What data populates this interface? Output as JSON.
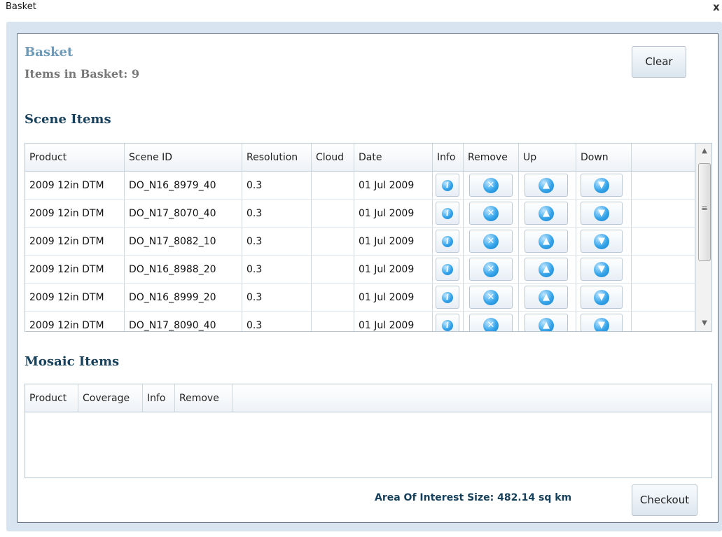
{
  "window": {
    "title": "Basket",
    "close_glyph": "x"
  },
  "header": {
    "title": "Basket",
    "count_text": "Items in Basket: 9"
  },
  "actions": {
    "clear_label": "Clear",
    "checkout_label": "Checkout"
  },
  "scene": {
    "section_title": "Scene Items",
    "columns": [
      "Product",
      "Scene ID",
      "Resolution",
      "Cloud",
      "Date",
      "Info",
      "Remove",
      "Up",
      "Down"
    ],
    "rows": [
      {
        "product": "2009 12in DTM",
        "scene_id": "DO_N16_8979_40",
        "resolution": "0.3",
        "cloud": "",
        "date": "01 Jul 2009"
      },
      {
        "product": "2009 12in DTM",
        "scene_id": "DO_N17_8070_40",
        "resolution": "0.3",
        "cloud": "",
        "date": "01 Jul 2009"
      },
      {
        "product": "2009 12in DTM",
        "scene_id": "DO_N17_8082_10",
        "resolution": "0.3",
        "cloud": "",
        "date": "01 Jul 2009"
      },
      {
        "product": "2009 12in DTM",
        "scene_id": "DO_N16_8988_20",
        "resolution": "0.3",
        "cloud": "",
        "date": "01 Jul 2009"
      },
      {
        "product": "2009 12in DTM",
        "scene_id": "DO_N16_8999_20",
        "resolution": "0.3",
        "cloud": "",
        "date": "01 Jul 2009"
      },
      {
        "product": "2009 12in DTM",
        "scene_id": "DO_N17_8090_40",
        "resolution": "0.3",
        "cloud": "",
        "date": "01 Jul 2009"
      }
    ]
  },
  "mosaic": {
    "section_title": "Mosaic Items",
    "columns": [
      "Product",
      "Coverage",
      "Info",
      "Remove"
    ]
  },
  "footer": {
    "aoi_text": "Area Of Interest Size: 482.14 sq km"
  },
  "icons": {
    "info": "info-icon",
    "remove": "remove-icon",
    "up": "move-up-icon",
    "down": "move-down-icon",
    "info_glyph": "i",
    "remove_glyph": "✕",
    "up_glyph": "▲",
    "down_glyph": "▼",
    "scroll_up_glyph": "▲",
    "scroll_down_glyph": "▼",
    "scroll_grip_glyph": "≡"
  },
  "colors": {
    "title": "#6d9ab8",
    "section": "#17405c",
    "icon_blue": "#34a4ea",
    "frame": "#d8e4f0"
  }
}
